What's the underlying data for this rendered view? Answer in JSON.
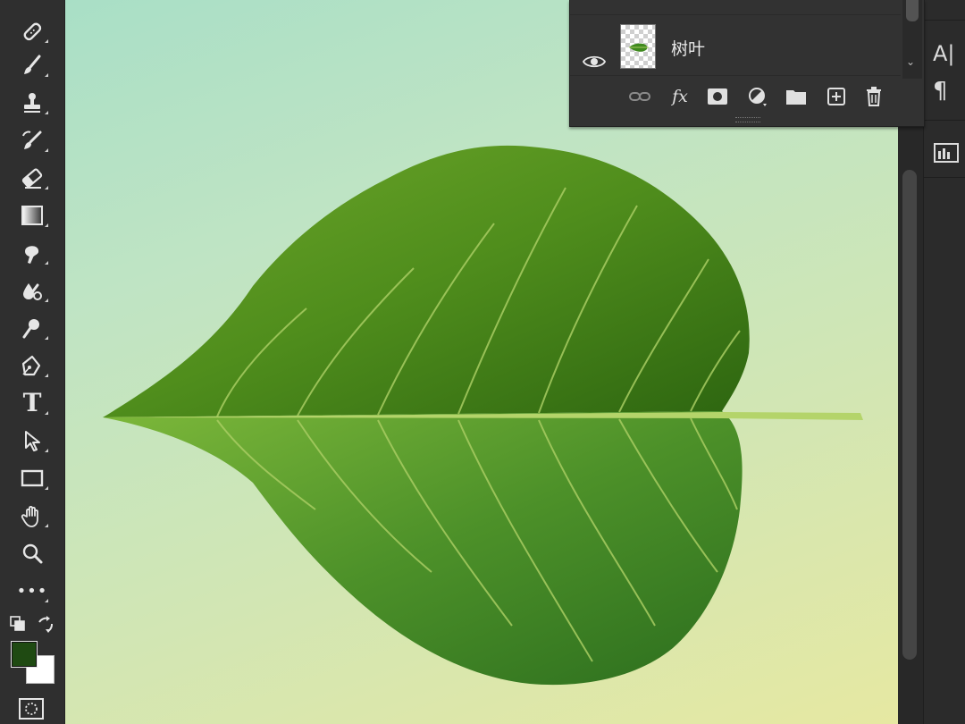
{
  "toolbar": {
    "tools": [
      {
        "name": "spot-healing-brush-tool"
      },
      {
        "name": "brush-tool"
      },
      {
        "name": "clone-stamp-tool"
      },
      {
        "name": "history-brush-tool"
      },
      {
        "name": "eraser-tool"
      },
      {
        "name": "gradient-tool"
      },
      {
        "name": "smudge-tool"
      },
      {
        "name": "blur-tool"
      },
      {
        "name": "dodge-tool"
      },
      {
        "name": "pen-tool"
      },
      {
        "name": "type-tool",
        "glyph": "T"
      },
      {
        "name": "path-selection-tool"
      },
      {
        "name": "rectangle-tool"
      },
      {
        "name": "hand-tool"
      },
      {
        "name": "zoom-tool"
      },
      {
        "name": "edit-toolbar",
        "glyph": "•••"
      }
    ],
    "foreground_color": "#1f4a12",
    "background_color": "#ffffff"
  },
  "layers_panel": {
    "layers": [
      {
        "name": "",
        "visible": false
      },
      {
        "name": "树叶",
        "visible": true
      }
    ],
    "footer_buttons": [
      "link-layers",
      "fx",
      "add-mask",
      "adjustment-layer",
      "new-group",
      "new-layer",
      "delete-layer"
    ],
    "fx_label": "fx"
  },
  "right_panel": {
    "icons": [
      "character-panel-icon",
      "paragraph-panel-icon",
      "libraries-panel-icon"
    ],
    "character_label": "A|",
    "paragraph_label": "¶"
  },
  "canvas": {
    "background_top": "#a9dfc6",
    "background_bottom": "#e6e8a2",
    "leaf_color_dark": "#2f6b12",
    "leaf_color_light": "#7fb23a"
  }
}
